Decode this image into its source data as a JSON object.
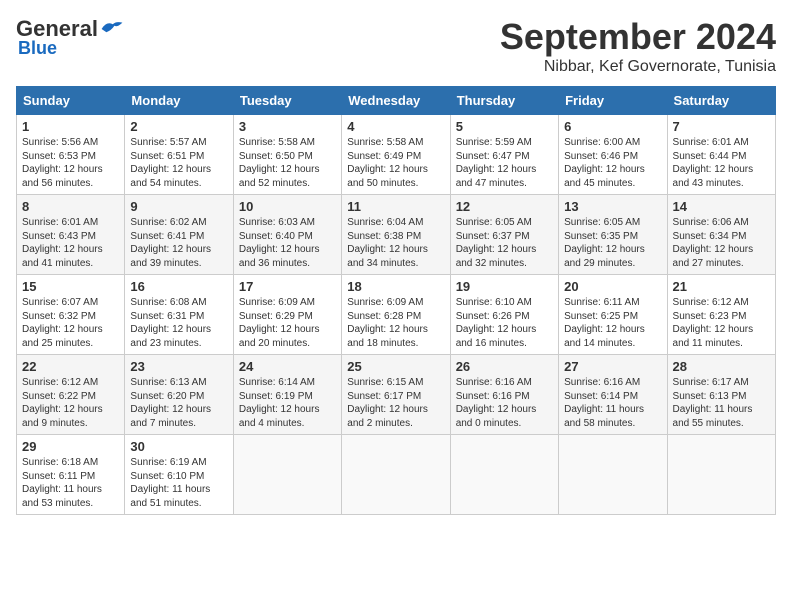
{
  "header": {
    "logo_general": "General",
    "logo_blue": "Blue",
    "month_title": "September 2024",
    "location": "Nibbar, Kef Governorate, Tunisia"
  },
  "weekdays": [
    "Sunday",
    "Monday",
    "Tuesday",
    "Wednesday",
    "Thursday",
    "Friday",
    "Saturday"
  ],
  "weeks": [
    [
      {
        "day": "1",
        "info": "Sunrise: 5:56 AM\nSunset: 6:53 PM\nDaylight: 12 hours\nand 56 minutes."
      },
      {
        "day": "2",
        "info": "Sunrise: 5:57 AM\nSunset: 6:51 PM\nDaylight: 12 hours\nand 54 minutes."
      },
      {
        "day": "3",
        "info": "Sunrise: 5:58 AM\nSunset: 6:50 PM\nDaylight: 12 hours\nand 52 minutes."
      },
      {
        "day": "4",
        "info": "Sunrise: 5:58 AM\nSunset: 6:49 PM\nDaylight: 12 hours\nand 50 minutes."
      },
      {
        "day": "5",
        "info": "Sunrise: 5:59 AM\nSunset: 6:47 PM\nDaylight: 12 hours\nand 47 minutes."
      },
      {
        "day": "6",
        "info": "Sunrise: 6:00 AM\nSunset: 6:46 PM\nDaylight: 12 hours\nand 45 minutes."
      },
      {
        "day": "7",
        "info": "Sunrise: 6:01 AM\nSunset: 6:44 PM\nDaylight: 12 hours\nand 43 minutes."
      }
    ],
    [
      {
        "day": "8",
        "info": "Sunrise: 6:01 AM\nSunset: 6:43 PM\nDaylight: 12 hours\nand 41 minutes."
      },
      {
        "day": "9",
        "info": "Sunrise: 6:02 AM\nSunset: 6:41 PM\nDaylight: 12 hours\nand 39 minutes."
      },
      {
        "day": "10",
        "info": "Sunrise: 6:03 AM\nSunset: 6:40 PM\nDaylight: 12 hours\nand 36 minutes."
      },
      {
        "day": "11",
        "info": "Sunrise: 6:04 AM\nSunset: 6:38 PM\nDaylight: 12 hours\nand 34 minutes."
      },
      {
        "day": "12",
        "info": "Sunrise: 6:05 AM\nSunset: 6:37 PM\nDaylight: 12 hours\nand 32 minutes."
      },
      {
        "day": "13",
        "info": "Sunrise: 6:05 AM\nSunset: 6:35 PM\nDaylight: 12 hours\nand 29 minutes."
      },
      {
        "day": "14",
        "info": "Sunrise: 6:06 AM\nSunset: 6:34 PM\nDaylight: 12 hours\nand 27 minutes."
      }
    ],
    [
      {
        "day": "15",
        "info": "Sunrise: 6:07 AM\nSunset: 6:32 PM\nDaylight: 12 hours\nand 25 minutes."
      },
      {
        "day": "16",
        "info": "Sunrise: 6:08 AM\nSunset: 6:31 PM\nDaylight: 12 hours\nand 23 minutes."
      },
      {
        "day": "17",
        "info": "Sunrise: 6:09 AM\nSunset: 6:29 PM\nDaylight: 12 hours\nand 20 minutes."
      },
      {
        "day": "18",
        "info": "Sunrise: 6:09 AM\nSunset: 6:28 PM\nDaylight: 12 hours\nand 18 minutes."
      },
      {
        "day": "19",
        "info": "Sunrise: 6:10 AM\nSunset: 6:26 PM\nDaylight: 12 hours\nand 16 minutes."
      },
      {
        "day": "20",
        "info": "Sunrise: 6:11 AM\nSunset: 6:25 PM\nDaylight: 12 hours\nand 14 minutes."
      },
      {
        "day": "21",
        "info": "Sunrise: 6:12 AM\nSunset: 6:23 PM\nDaylight: 12 hours\nand 11 minutes."
      }
    ],
    [
      {
        "day": "22",
        "info": "Sunrise: 6:12 AM\nSunset: 6:22 PM\nDaylight: 12 hours\nand 9 minutes."
      },
      {
        "day": "23",
        "info": "Sunrise: 6:13 AM\nSunset: 6:20 PM\nDaylight: 12 hours\nand 7 minutes."
      },
      {
        "day": "24",
        "info": "Sunrise: 6:14 AM\nSunset: 6:19 PM\nDaylight: 12 hours\nand 4 minutes."
      },
      {
        "day": "25",
        "info": "Sunrise: 6:15 AM\nSunset: 6:17 PM\nDaylight: 12 hours\nand 2 minutes."
      },
      {
        "day": "26",
        "info": "Sunrise: 6:16 AM\nSunset: 6:16 PM\nDaylight: 12 hours\nand 0 minutes."
      },
      {
        "day": "27",
        "info": "Sunrise: 6:16 AM\nSunset: 6:14 PM\nDaylight: 11 hours\nand 58 minutes."
      },
      {
        "day": "28",
        "info": "Sunrise: 6:17 AM\nSunset: 6:13 PM\nDaylight: 11 hours\nand 55 minutes."
      }
    ],
    [
      {
        "day": "29",
        "info": "Sunrise: 6:18 AM\nSunset: 6:11 PM\nDaylight: 11 hours\nand 53 minutes."
      },
      {
        "day": "30",
        "info": "Sunrise: 6:19 AM\nSunset: 6:10 PM\nDaylight: 11 hours\nand 51 minutes."
      },
      {
        "day": "",
        "info": ""
      },
      {
        "day": "",
        "info": ""
      },
      {
        "day": "",
        "info": ""
      },
      {
        "day": "",
        "info": ""
      },
      {
        "day": "",
        "info": ""
      }
    ]
  ]
}
